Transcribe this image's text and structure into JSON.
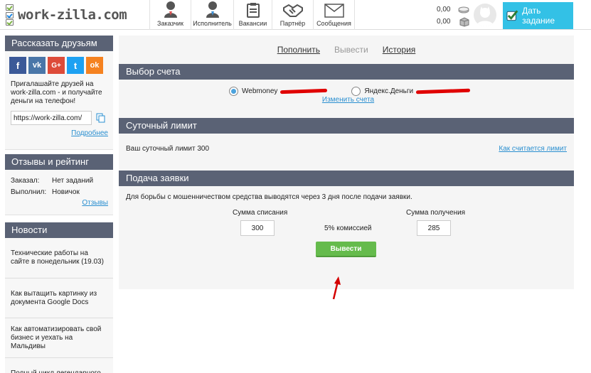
{
  "header": {
    "logo": "work-zilla.com",
    "nav": [
      {
        "label": "Заказчик",
        "icon": "customer-person-icon"
      },
      {
        "label": "Исполнитель",
        "icon": "freelancer-person-icon"
      },
      {
        "label": "Вакансии",
        "icon": "clipboard-icon"
      },
      {
        "label": "Партнёр",
        "icon": "handshake-icon"
      },
      {
        "label": "Сообщения",
        "icon": "envelope-icon"
      }
    ],
    "balance_money": "0,00",
    "balance_points": "0,00",
    "task_button": "Дать задание"
  },
  "sidebar": {
    "share": {
      "title": "Рассказать друзьям",
      "socials": [
        {
          "label": "f",
          "color": "#3b5998",
          "icon": "facebook-icon"
        },
        {
          "label": "vk",
          "color": "#4a76a8",
          "icon": "vk-icon"
        },
        {
          "label": "G+",
          "color": "#dd4b39",
          "icon": "google-plus-icon"
        },
        {
          "label": "t",
          "color": "#1da1f2",
          "icon": "twitter-icon"
        },
        {
          "label": "ok",
          "color": "#f58220",
          "icon": "odnoklassniki-icon"
        }
      ],
      "text": "Пригалашайте друзей на work-zilla.com - и получайте деньги на телефон!",
      "url": "https://work-zilla.com/",
      "more_link": "Подробнее"
    },
    "reviews": {
      "title": "Отзывы и рейтинг",
      "ordered_label": "Заказал:",
      "ordered_value": "Нет заданий",
      "done_label": "Выполнил:",
      "done_value": "Новичок",
      "link": "Отзывы"
    },
    "news": {
      "title": "Новости",
      "items": [
        "Технические работы на сайте в понедельник (19.03)",
        "Как вытащить картинку из документа Google Docs",
        "Как автоматизировать свой бизнес и уехать на Мальдивы",
        "Полный цикл легендарного контента (инфографика)"
      ]
    }
  },
  "main": {
    "tabs": [
      {
        "label": "Пополнить",
        "active": false
      },
      {
        "label": "Вывести",
        "active": true
      },
      {
        "label": "История",
        "active": false
      }
    ],
    "account": {
      "title": "Выбор счета",
      "option1": "Webmoney",
      "option2": "Яндекс.Деньги",
      "change_link": "Изменить счета"
    },
    "limit": {
      "title": "Суточный лимит",
      "text": "Ваш суточный лимит 300",
      "link": "Как считается лимит"
    },
    "request": {
      "title": "Подача заявки",
      "notice": "Для борьбы с мошенничеством средства выводятся через 3 дня после подачи заявки.",
      "debit_label": "Сумма списания",
      "debit_value": "300",
      "commission": "5% комиссией",
      "receive_label": "Сумма получения",
      "receive_value": "285",
      "submit": "Вывести"
    }
  },
  "colors": {
    "section_header": "#5a6275",
    "accent_button": "#33c1e6",
    "submit_button": "#65bb4c",
    "link": "#2a8fd0",
    "redaction": "#e00000"
  }
}
